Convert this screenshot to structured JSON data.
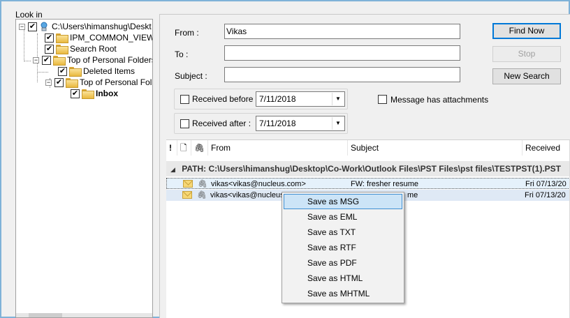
{
  "look_in": {
    "label": "Look in",
    "tree": [
      {
        "label": "C:\\Users\\himanshug\\Deskt",
        "expander": "−",
        "checked": true
      },
      {
        "label": "IPM_COMMON_VIEWS",
        "checked": true
      },
      {
        "label": "Search Root",
        "checked": true
      },
      {
        "label": "Top of Personal Folders",
        "expander": "−",
        "checked": true
      },
      {
        "label": "Deleted Items",
        "checked": true
      },
      {
        "label": "Top of Personal Fol",
        "expander": "−",
        "checked": true
      },
      {
        "label": "Inbox",
        "checked": true,
        "bold": true
      }
    ]
  },
  "search": {
    "from_label": "From :",
    "from_value": "Vikas",
    "to_label": "To :",
    "to_value": "",
    "subject_label": "Subject :",
    "subject_value": "",
    "received_before_label": "Received before :",
    "received_before_date": "7/11/2018",
    "received_after_label": "Received after :",
    "received_after_date": "7/11/2018",
    "attachments_label": "Message has attachments"
  },
  "buttons": {
    "find_now": "Find Now",
    "stop": "Stop",
    "new_search": "New Search"
  },
  "results": {
    "columns": {
      "importance": "!",
      "type": "🗋",
      "attachment": "🖇",
      "from": "From",
      "subject": "Subject",
      "received": "Received"
    },
    "path": "PATH: C:\\Users\\himanshug\\Desktop\\Co-Work\\Outlook Files\\PST Files\\pst files\\TESTPST(1).PST",
    "rows": [
      {
        "from": "vikas<vikas@nucleus.com>",
        "subject": "FW: fresher resume",
        "received": "Fri 07/13/20"
      },
      {
        "from": "vikas<vikas@nucleus",
        "subject": "me",
        "received": "Fri 07/13/20"
      }
    ]
  },
  "context_menu": {
    "items": [
      "Save as MSG",
      "Save as EML",
      "Save as TXT",
      "Save as RTF",
      "Save as PDF",
      "Save as HTML",
      "Save as MHTML"
    ]
  }
}
